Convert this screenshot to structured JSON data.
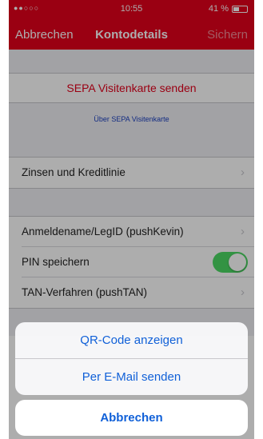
{
  "status": {
    "signal": "●●○○○",
    "time": "10:55",
    "battery": "41 %"
  },
  "nav": {
    "cancel": "Abbrechen",
    "title": "Kontodetails",
    "save": "Sichern"
  },
  "sepa": {
    "send": "SEPA Visitenkarte senden",
    "about": "Über SEPA Visitenkarte"
  },
  "rows": {
    "interest": "Zinsen und Kreditlinie",
    "login": "Anmeldename/LegID (pushKevin)",
    "pin": "PIN speichern",
    "pin_enabled": true,
    "tan": "TAN-Verfahren (pushTAN)"
  },
  "sheet": {
    "qr": "QR-Code anzeigen",
    "email": "Per E-Mail senden",
    "cancel": "Abbrechen"
  },
  "colors": {
    "brand": "#e3001b",
    "accent": "#1060d8",
    "toggle_on": "#4cd964"
  }
}
